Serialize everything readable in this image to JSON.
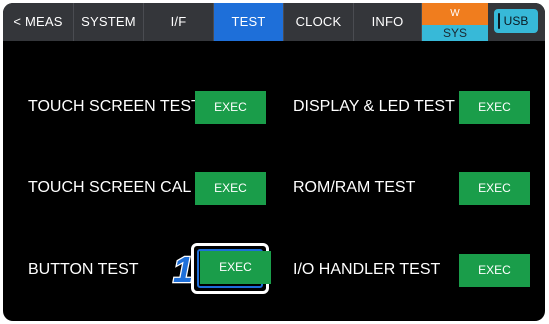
{
  "tabs": {
    "meas": "< MEAS",
    "system": "SYSTEM",
    "if": "I/F",
    "test": "TEST",
    "clock": "CLOCK",
    "info": "INFO"
  },
  "status": {
    "top": "W",
    "bottom": "SYS",
    "usb": "USB"
  },
  "tests": {
    "touch_screen_test": "TOUCH SCREEN TEST",
    "display_led_test": "DISPLAY & LED TEST",
    "touch_screen_cal": "TOUCH SCREEN CAL",
    "rom_ram_test": "ROM/RAM TEST",
    "button_test": "BUTTON TEST",
    "io_handler_test": "I/O HANDLER TEST",
    "exec_label": "EXEC"
  },
  "callout": {
    "step_number": "1"
  },
  "colors": {
    "active_tab": "#1e6fd9",
    "exec_button": "#1a9d4a",
    "sys_orange": "#f07d1e",
    "sys_cyan": "#37b9d8"
  }
}
